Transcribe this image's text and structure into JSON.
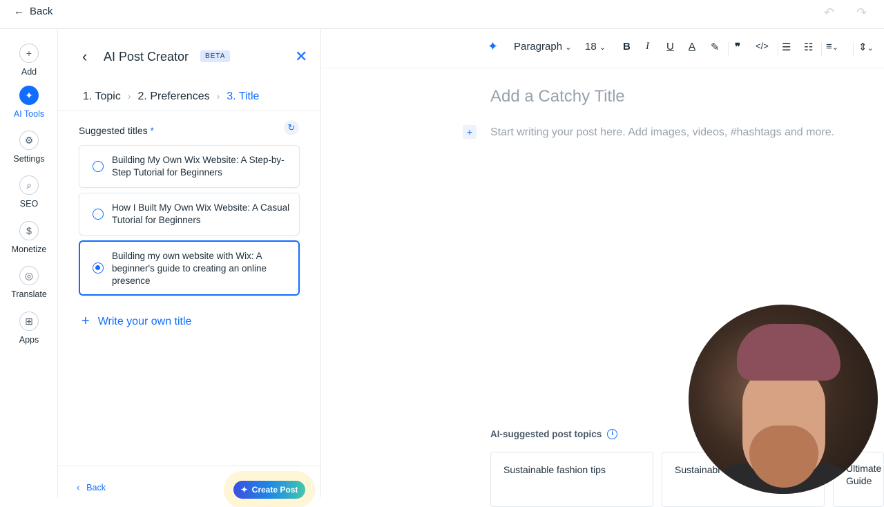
{
  "topbar": {
    "back_label": "Back"
  },
  "rail": {
    "items": [
      {
        "label": "Add",
        "icon": "+"
      },
      {
        "label": "AI Tools",
        "icon": "✦"
      },
      {
        "label": "Settings",
        "icon": "⚙"
      },
      {
        "label": "SEO",
        "icon": "⌕"
      },
      {
        "label": "Monetize",
        "icon": "$"
      },
      {
        "label": "Translate",
        "icon": "◎"
      },
      {
        "label": "Apps",
        "icon": "⊞"
      }
    ]
  },
  "panel": {
    "title": "AI Post Creator",
    "badge": "BETA",
    "steps": [
      {
        "num": "1.",
        "label": "Topic"
      },
      {
        "num": "2.",
        "label": "Preferences"
      },
      {
        "num": "3.",
        "label": "Title"
      }
    ],
    "suggested_label": "Suggested titles",
    "required_mark": "*",
    "options": [
      {
        "text": "Building My Own Wix Website: A Step-by-Step Tutorial for Beginners",
        "selected": false
      },
      {
        "text": "How I Built My Own Wix Website: A Casual Tutorial for Beginners",
        "selected": false
      },
      {
        "text": "Building my own website with Wix: A beginner's guide to creating an online presence",
        "selected": true
      }
    ],
    "write_own_label": "Write your own title",
    "footer": {
      "back_label": "Back",
      "create_label": "Create Post"
    }
  },
  "toolbar": {
    "paragraph_label": "Paragraph",
    "font_size": "18"
  },
  "editor": {
    "title_placeholder": "Add a Catchy Title",
    "body_placeholder": "Start writing your post here. Add images, videos, #hashtags and more.",
    "ai_topics_label": "AI-suggested post topics",
    "topic_cards": [
      "Sustainable fashion tips",
      "Sustainabl",
      "Ultimate Guide"
    ]
  },
  "colors": {
    "accent": "#116dff",
    "text": "#20303c",
    "placeholder": "#98a2ad"
  }
}
